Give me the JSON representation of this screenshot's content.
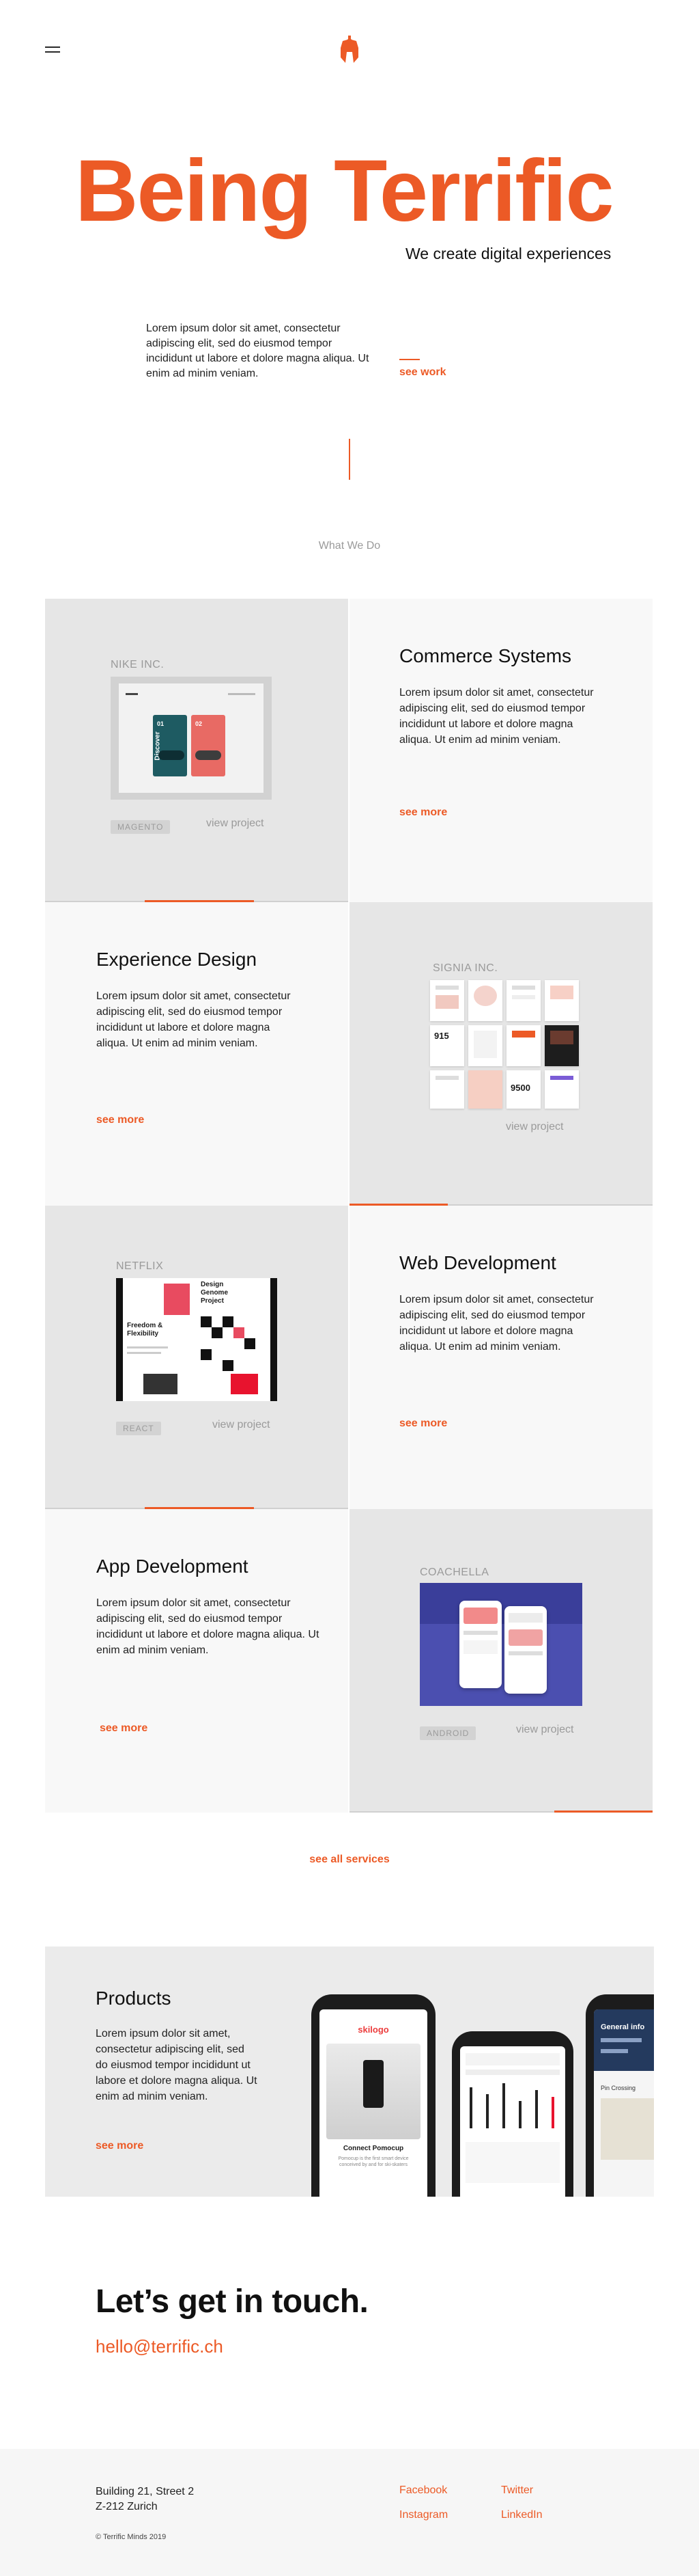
{
  "header": {
    "menu_icon": "hamburger-icon",
    "logo_icon": "spartan-helmet-logo"
  },
  "hero": {
    "title": "Being Terrific",
    "subtitle": "We create digital experiences",
    "text": "Lorem ipsum dolor sit amet, consectetur adipiscing elit, sed do eiusmod tempor incididunt ut labore et dolore magna aliqua. Ut enim ad minim veniam.",
    "link": "see work"
  },
  "section_label": "What We Do",
  "services": [
    {
      "title": "Commerce Systems",
      "text": "Lorem ipsum dolor sit amet, consectetur adipiscing elit, sed do eiusmod tempor incididunt ut labore et dolore magna aliqua. Ut enim ad minim veniam.",
      "more": "see more",
      "project": {
        "client": "NIKE INC.",
        "tag": "MAGENTO",
        "view": "view project"
      }
    },
    {
      "title": "Experience Design",
      "text": "Lorem ipsum dolor sit amet, consectetur adipiscing elit, sed do eiusmod tempor incididunt ut labore et dolore magna aliqua. Ut enim ad minim veniam.",
      "more": "see more",
      "project": {
        "client": "SIGNIA INC.",
        "view": "view project"
      }
    },
    {
      "title": "Web Development",
      "text": "Lorem ipsum dolor sit amet, consectetur adipiscing elit, sed do eiusmod tempor incididunt ut labore et dolore magna aliqua. Ut enim ad minim veniam.",
      "more": "see more",
      "project": {
        "client": "NETFLIX",
        "tag": "REACT",
        "view": "view project"
      }
    },
    {
      "title": "App Development",
      "text": "Lorem ipsum dolor sit amet, consectetur adipiscing elit, sed do eiusmod tempor incididunt ut labore et dolore magna aliqua. Ut enim ad minim veniam.",
      "more": "see more",
      "project": {
        "client": "COACHELLA",
        "tag": "ANDROID",
        "view": "view project"
      }
    }
  ],
  "mockups": {
    "nike": {
      "card1_num": "01",
      "card2_num": "02",
      "card_word": "Discover"
    },
    "signia": {
      "stat1": "915",
      "stat2": "9500"
    },
    "netflix": {
      "heading1": "Design Genome Project",
      "heading2": "Freedom & Flexibility"
    }
  },
  "see_all": "see all services",
  "products": {
    "title": "Products",
    "text": "Lorem ipsum dolor sit amet, consectetur adipiscing elit, sed do eiusmod tempor incididunt ut labore et dolore magna aliqua. Ut enim ad minim veniam.",
    "more": "see more",
    "phone1": {
      "brand": "skilogo",
      "caption": "Connect Pomocup",
      "body": "Pomocup is the first smart device conceived by and for ski-skaters"
    },
    "phone3": {
      "heading": "General info",
      "row1": "Pin Crossing"
    }
  },
  "contact": {
    "title": "Let’s get in touch.",
    "email": "hello@terrific.ch"
  },
  "footer": {
    "address_line1": "Building 21, Street 2",
    "address_line2": "Z-212 Zurich",
    "copyright": "© Terrific Minds 2019",
    "links": [
      "Facebook",
      "Twitter",
      "Instagram",
      "LinkedIn"
    ]
  }
}
